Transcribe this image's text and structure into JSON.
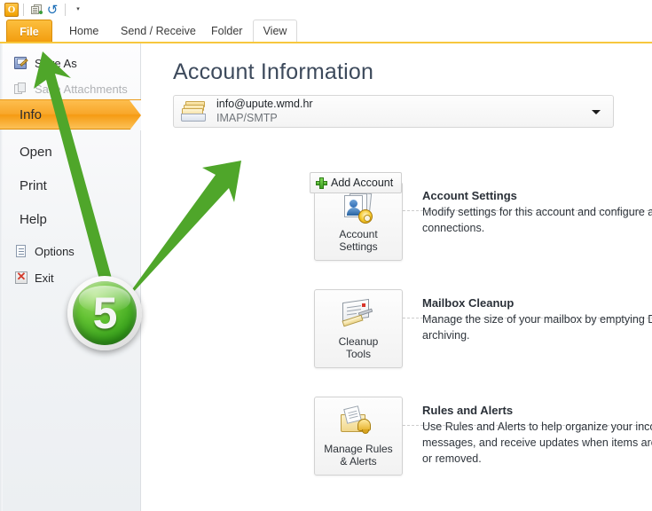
{
  "quick_access": {
    "logo_text": "O",
    "items": [
      {
        "name": "outlook-logo",
        "label": "O"
      },
      {
        "name": "send-receive-icon",
        "label": "Send/Receive All Folders"
      },
      {
        "name": "undo-icon",
        "label": "Undo"
      },
      {
        "name": "customize-dropdown-icon",
        "label": "Customize Quick Access Toolbar"
      }
    ],
    "undo_glyph": "↺",
    "caret_glyph": "▾"
  },
  "ribbon": {
    "tabs": [
      {
        "label": "File",
        "name": "tab-file",
        "state": "active"
      },
      {
        "label": "Home",
        "name": "tab-home",
        "state": "normal"
      },
      {
        "label": "Send / Receive",
        "name": "tab-send-receive",
        "state": "normal"
      },
      {
        "label": "Folder",
        "name": "tab-folder",
        "state": "normal"
      },
      {
        "label": "View",
        "name": "tab-view",
        "state": "selected"
      }
    ]
  },
  "sidebar": {
    "items": [
      {
        "label": "Save As",
        "name": "sidebar-item-save-as",
        "icon": "save-as-icon",
        "state": "enabled",
        "style": "icon"
      },
      {
        "label": "Save Attachments",
        "name": "sidebar-item-save-attachments",
        "icon": "attachment-icon",
        "state": "disabled",
        "style": "icon"
      },
      {
        "label": "Info",
        "name": "sidebar-item-info",
        "icon": "",
        "state": "selected",
        "style": "big"
      },
      {
        "label": "Open",
        "name": "sidebar-item-open",
        "icon": "",
        "state": "enabled",
        "style": "big"
      },
      {
        "label": "Print",
        "name": "sidebar-item-print",
        "icon": "",
        "state": "enabled",
        "style": "big"
      },
      {
        "label": "Help",
        "name": "sidebar-item-help",
        "icon": "",
        "state": "enabled",
        "style": "big"
      },
      {
        "label": "Options",
        "name": "sidebar-item-options",
        "icon": "options-icon",
        "state": "enabled",
        "style": "icon"
      },
      {
        "label": "Exit",
        "name": "sidebar-item-exit",
        "icon": "exit-icon",
        "state": "enabled",
        "style": "icon"
      }
    ],
    "exit_glyph": "✕"
  },
  "main": {
    "title": "Account Information",
    "account_selector": {
      "email": "info@upute.wmd.hr",
      "protocol": "IMAP/SMTP",
      "icon": "mail-folder-icon",
      "caret": "▾"
    },
    "add_account_button": {
      "label": "Add Account",
      "icon": "plus-icon"
    },
    "sections": [
      {
        "name": "account-settings",
        "button_caption": "Account\nSettings",
        "button_has_dropdown": true,
        "dropdown_glyph": "▾",
        "icon": "account-settings-icon",
        "title": "Account Settings",
        "description": "Modify settings for this account and configure additional connections."
      },
      {
        "name": "mailbox-cleanup",
        "button_caption": "Cleanup\nTools",
        "button_has_dropdown": true,
        "dropdown_glyph": "▾",
        "icon": "cleanup-tools-icon",
        "title": "Mailbox Cleanup",
        "description": "Manage the size of your mailbox by emptying Deleted Items and archiving."
      },
      {
        "name": "rules-and-alerts",
        "button_caption": "Manage Rules\n& Alerts",
        "button_has_dropdown": false,
        "dropdown_glyph": "",
        "icon": "rules-alerts-icon",
        "title": "Rules and Alerts",
        "description": "Use Rules and Alerts to help organize your incoming e-mail messages, and receive updates when items are added, changed, or removed."
      }
    ]
  },
  "annotation": {
    "step_number": "5",
    "arrow_color": "#4fa62a",
    "badge_color": "#45ad1f",
    "arrows": [
      {
        "name": "arrow-to-save-as",
        "target": "Save As"
      },
      {
        "name": "arrow-to-add-account",
        "target": "Add Account"
      }
    ]
  }
}
